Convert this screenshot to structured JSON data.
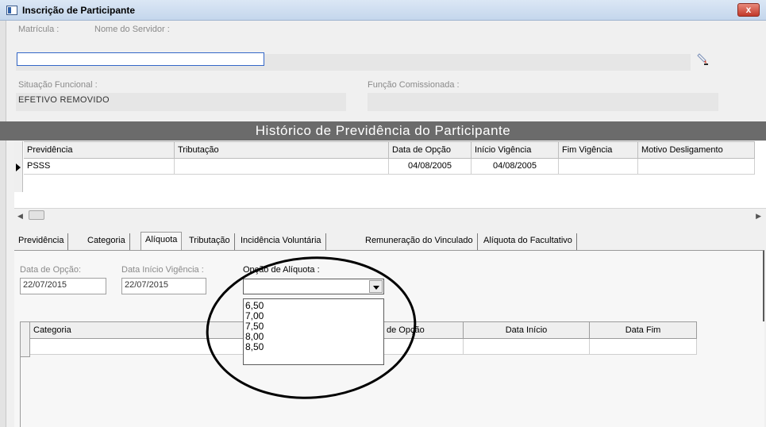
{
  "window": {
    "title": "Inscrição de Participante",
    "close_glyph": "x"
  },
  "header": {
    "matricula_label": "Matrícula :",
    "nome_label": "Nome do Servidor :",
    "matricula_value": "",
    "situacao_label": "Situação Funcional :",
    "situacao_value": "EFETIVO REMOVIDO",
    "funcao_label": "Função Comissionada :",
    "funcao_value": ""
  },
  "history": {
    "title": "Histórico de Previdência do Participante",
    "columns": [
      "Previdência",
      "Tributação",
      "Data de Opção",
      "Início Vigência",
      "Fim Vigência",
      "Motivo Desligamento"
    ],
    "rows": [
      {
        "previdencia": "PSSS",
        "tributacao": "",
        "data_opcao": "04/08/2005",
        "inicio_vigencia": "04/08/2005",
        "fim_vigencia": "",
        "motivo": ""
      }
    ]
  },
  "tabs": [
    {
      "label": "Previdência"
    },
    {
      "label": "Categoria"
    },
    {
      "label": "Alíquota"
    },
    {
      "label": "Tributação"
    },
    {
      "label": "Incidência Voluntária"
    },
    {
      "label": "Remuneração do Vinculado"
    },
    {
      "label": "Alíquota do Facultativo"
    }
  ],
  "active_tab": "Alíquota",
  "aliquota_tab": {
    "data_opcao_label": "Data de Opção:",
    "data_opcao_value": "22/07/2015",
    "data_inicio_label": "Data Início Vigência :",
    "data_inicio_value": "22/07/2015",
    "opcao_label": "Opção de Alíquota :",
    "opcao_value": "",
    "options": [
      "6,50",
      "7,00",
      "7,50",
      "8,00",
      "8,50"
    ],
    "grid_columns": [
      "Categoria",
      "de Opção",
      "Data Início",
      "Data Fim"
    ]
  },
  "icons": {
    "lookup": "pencil-lookup-icon",
    "close": "close-icon",
    "dropdown": "chevron-down-icon"
  }
}
